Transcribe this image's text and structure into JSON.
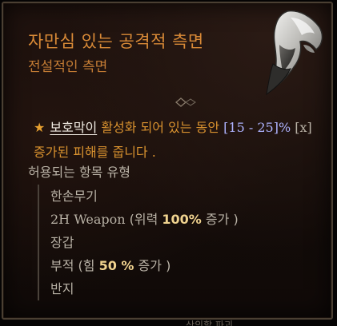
{
  "tooltip": {
    "title": "자만심 있는 공격적 측면",
    "subtitle": "전설적인 측면",
    "item_art_icon": "scythe-blade-icon",
    "affix": {
      "star": "★",
      "keyword": "보호막이",
      "text_a": " 활성화 되어 있는 동안 ",
      "value": "[15 - 25]%",
      "tag": " [x]",
      "text_b": " 증가된 피해를 줍니다 ."
    },
    "allowed_header": "허용되는 항목 유형",
    "allowed_items": [
      {
        "name": "한손무기"
      },
      {
        "name_en": "2H Weapon",
        "paren_open": " (위력 ",
        "num": "100%",
        "paren_close": " 증가 )"
      },
      {
        "name": "장갑"
      },
      {
        "name": "부적",
        "paren_open": " (힘 ",
        "num": "50 %",
        "paren_close": " 증가 )"
      },
      {
        "name": "반지"
      }
    ],
    "cutoff_text": "상의할 파괴"
  },
  "colors": {
    "title": "#d98a37",
    "keyword": "#f2ede4",
    "value": "#aeb3ff",
    "body": "#b9b2a6",
    "highlight_number": "#f0d38f"
  }
}
